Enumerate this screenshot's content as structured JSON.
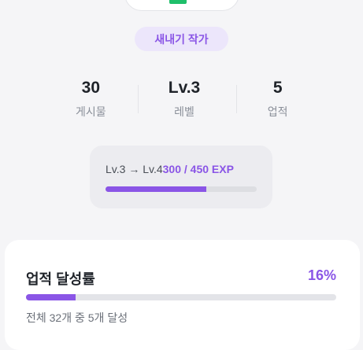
{
  "profile": {
    "title_badge": "새내기 작가",
    "stats": [
      {
        "value": "30",
        "label": "게시물"
      },
      {
        "value": "Lv.3",
        "label": "레벨"
      },
      {
        "value": "5",
        "label": "업적"
      }
    ]
  },
  "level_progress": {
    "from_to": "Lv.3 → Lv.4",
    "exp_text": "300 / 450 EXP",
    "fraction": 0.667
  },
  "achievements": {
    "title": "업적 달성률",
    "percent_text": "16%",
    "summary": "전체 32개 중 5개 달성",
    "fraction": 0.16
  },
  "colors": {
    "accent": "#8a55e6",
    "accent_bg": "#ece6fb",
    "status_green": "#1fbf6a"
  }
}
